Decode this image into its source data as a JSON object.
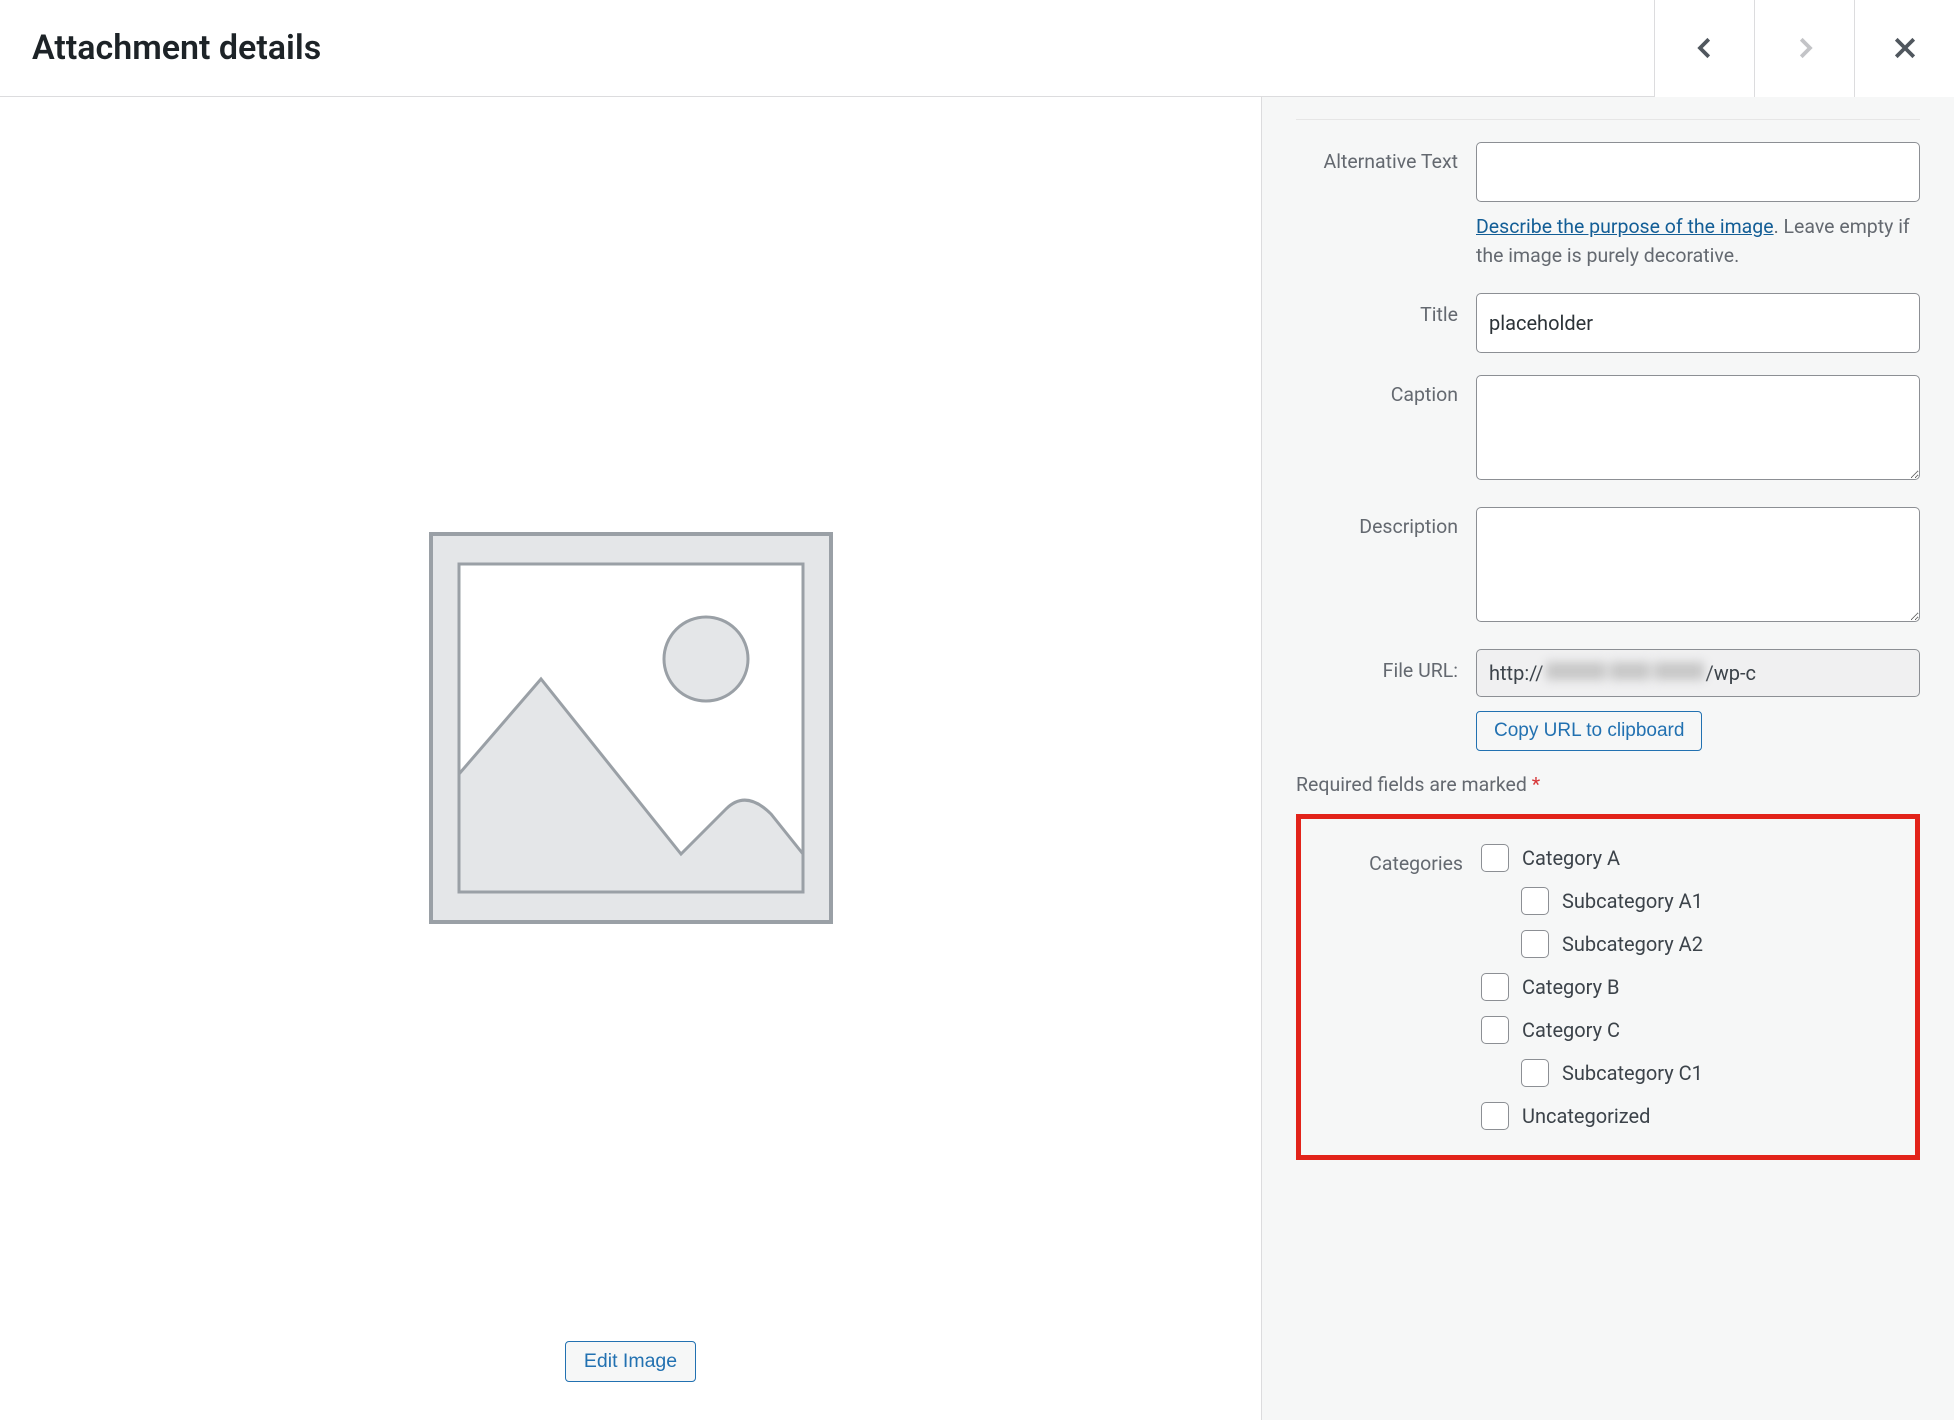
{
  "header": {
    "title": "Attachment details"
  },
  "preview": {
    "edit_button_label": "Edit Image"
  },
  "fields": {
    "alt_text": {
      "label": "Alternative Text",
      "value": "",
      "help_link": "Describe the purpose of the image",
      "help_tail": ". Leave empty if the image is purely decorative."
    },
    "title": {
      "label": "Title",
      "value": "placeholder"
    },
    "caption": {
      "label": "Caption",
      "value": ""
    },
    "description": {
      "label": "Description",
      "value": ""
    },
    "file_url": {
      "label": "File URL:",
      "value_prefix": "http://",
      "value_suffix": "/wp-c",
      "copy_label": "Copy URL to clipboard"
    }
  },
  "required_note": {
    "text": "Required fields are marked ",
    "mark": "*"
  },
  "categories": {
    "label": "Categories",
    "items": [
      {
        "label": "Category A",
        "indent": 0
      },
      {
        "label": "Subcategory A1",
        "indent": 1
      },
      {
        "label": "Subcategory A2",
        "indent": 1
      },
      {
        "label": "Category B",
        "indent": 0
      },
      {
        "label": "Category C",
        "indent": 0
      },
      {
        "label": "Subcategory C1",
        "indent": 1
      },
      {
        "label": "Uncategorized",
        "indent": 0
      }
    ]
  }
}
